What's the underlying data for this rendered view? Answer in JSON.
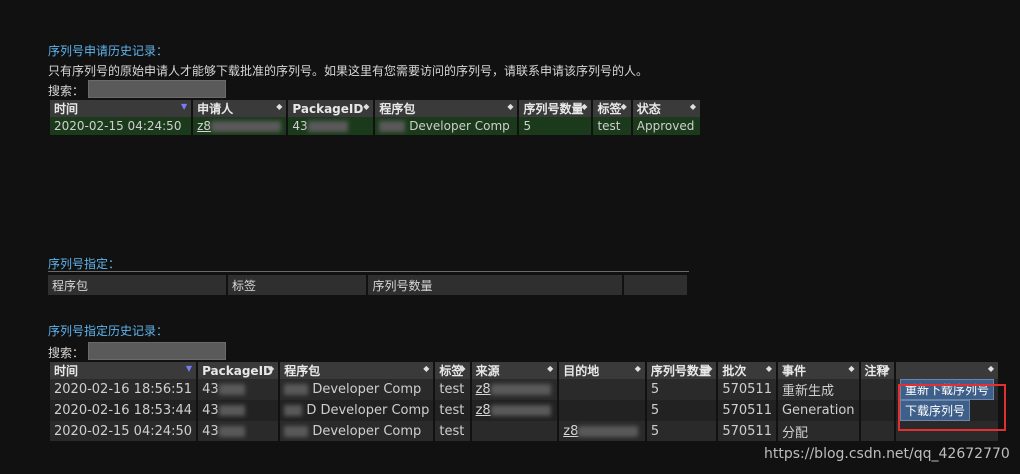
{
  "history": {
    "title": "序列号申请历史记录：",
    "description": "只有序列号的原始申请人才能够下载批准的序列号。如果这里有您需要访问的序列号，请联系申请该序列号的人。",
    "search_label": "搜索：",
    "columns": [
      "时间",
      "申请人",
      "PackageID",
      "程序包",
      "序列号数量",
      "标签",
      "状态"
    ],
    "rows": [
      {
        "time": "2020-02-15 04:24:50",
        "requester": "z8",
        "package_id": "43",
        "package": "Developer Comp",
        "count": "5",
        "tag": "test",
        "status": "Approved"
      }
    ]
  },
  "assign": {
    "title": "序列号指定：",
    "columns": [
      "程序包",
      "标签",
      "序列号数量",
      ""
    ]
  },
  "assign_history": {
    "title": "序列号指定历史记录：",
    "search_label": "搜索：",
    "columns": [
      "时间",
      "PackageID",
      "程序包",
      "标签",
      "来源",
      "目的地",
      "序列号数量",
      "批次",
      "事件",
      "注释",
      ""
    ],
    "rows": [
      {
        "time": "2020-02-16 18:56:51",
        "package_id": "43",
        "package": "Developer Comp",
        "tag": "test",
        "source": "z8",
        "dest": "",
        "count": "5",
        "batch": "570511",
        "event": "重新生成",
        "note": "",
        "action": "重新下载序列号"
      },
      {
        "time": "2020-02-16 18:53:44",
        "package_id": "43",
        "package": "D Developer Comp",
        "tag": "test",
        "source": "z8",
        "dest": "",
        "count": "5",
        "batch": "570511",
        "event": "Generation",
        "note": "",
        "action": "下载序列号"
      },
      {
        "time": "2020-02-15 04:24:50",
        "package_id": "43",
        "package": "Developer Comp",
        "tag": "test",
        "source": "",
        "dest": "z8",
        "count": "5",
        "batch": "570511",
        "event": "分配",
        "note": "",
        "action": ""
      }
    ]
  },
  "watermark": "https://blog.csdn.net/qq_42672770"
}
